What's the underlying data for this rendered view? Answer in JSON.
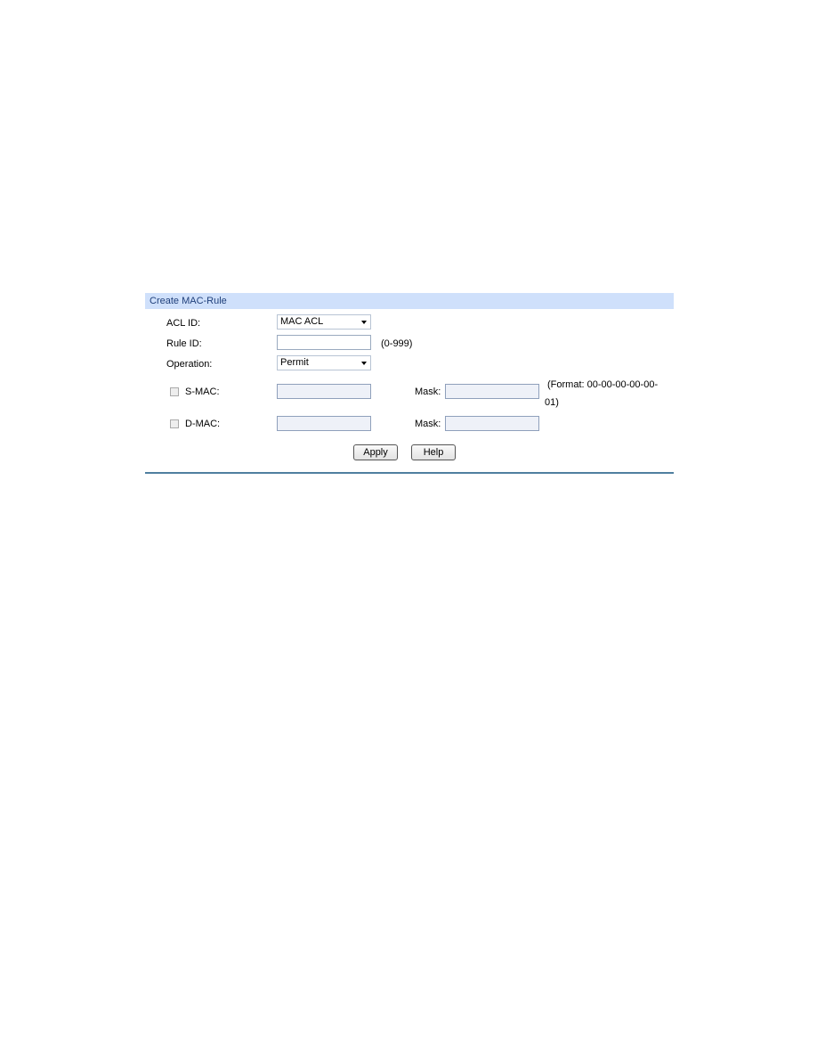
{
  "panel": {
    "title": "Create MAC-Rule"
  },
  "form": {
    "acl_id": {
      "label": "ACL ID:",
      "value": "MAC ACL"
    },
    "rule_id": {
      "label": "Rule ID:",
      "value": "",
      "hint": "(0-999)"
    },
    "operation": {
      "label": "Operation:",
      "value": "Permit"
    },
    "s_mac": {
      "label": "S-MAC:",
      "checked": false,
      "value": "",
      "mask_label": "Mask:",
      "mask_value": ""
    },
    "d_mac": {
      "label": "D-MAC:",
      "checked": false,
      "value": "",
      "mask_label": "Mask:",
      "mask_value": ""
    },
    "format_hint_line1": "(Format: 00-00-00-00-00-",
    "format_hint_line2": "01)"
  },
  "buttons": {
    "apply": "Apply",
    "help": "Help"
  }
}
